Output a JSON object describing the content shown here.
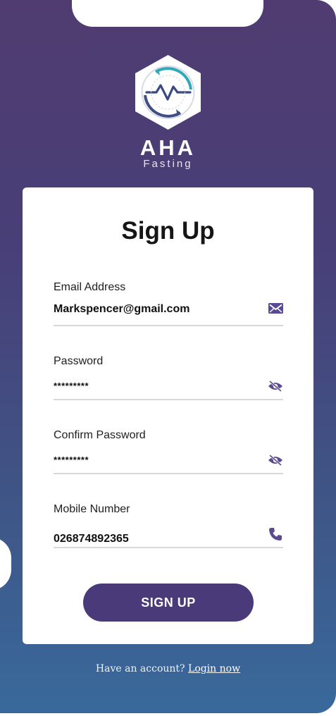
{
  "brand": {
    "name": "AHA",
    "tagline": "Fasting"
  },
  "form": {
    "title": "Sign Up",
    "fields": [
      {
        "label": "Email Address",
        "value": "Markspencer@gmail.com",
        "icon": "envelope-icon"
      },
      {
        "label": "Password",
        "value": "*********",
        "icon": "eye-slash-icon"
      },
      {
        "label": "Confirm Password",
        "value": "*********",
        "icon": "eye-slash-icon"
      },
      {
        "label": "Mobile Number",
        "value": "026874892365",
        "icon": "phone-icon"
      }
    ],
    "submit_label": "SIGN UP"
  },
  "footer": {
    "prompt": "Have an account?",
    "link": "Login now"
  },
  "colors": {
    "accent": "#4a3a7a",
    "gradient_top": "#503c70",
    "gradient_bottom": "#39699c",
    "icon": "#5b4a90"
  }
}
